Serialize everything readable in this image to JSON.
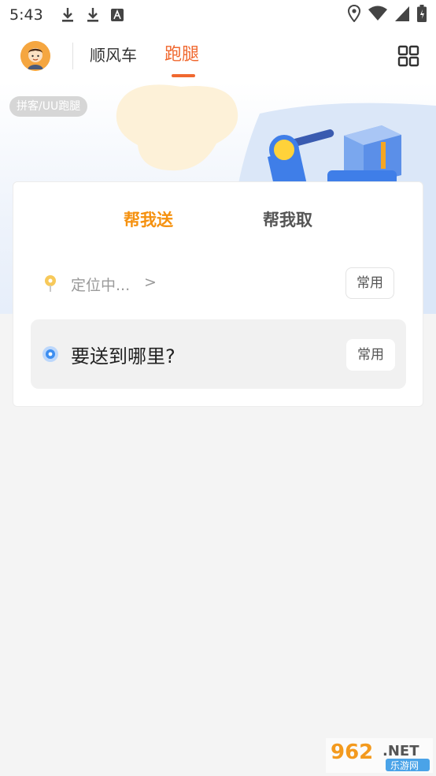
{
  "status_bar": {
    "time": "5:43"
  },
  "nav": {
    "tabs": [
      {
        "label": "顺风车"
      },
      {
        "label": "跑腿"
      }
    ],
    "active_tab": "跑腿"
  },
  "banner": {
    "tag": "拼客/UU跑腿"
  },
  "service_tabs": [
    {
      "label": "帮我送"
    },
    {
      "label": "帮我取"
    }
  ],
  "pickup": {
    "location_text": "定位中...",
    "chevron": ">",
    "common_label": "常用"
  },
  "destination": {
    "placeholder": "要送到哪里?",
    "common_label": "常用"
  },
  "colors": {
    "accent": "#f5910f",
    "nav_active": "#f0682f",
    "dest_dot": "#3d8ef0"
  },
  "watermark": {
    "number": "962",
    "suffix": ".NET",
    "caption": "乐游网"
  }
}
